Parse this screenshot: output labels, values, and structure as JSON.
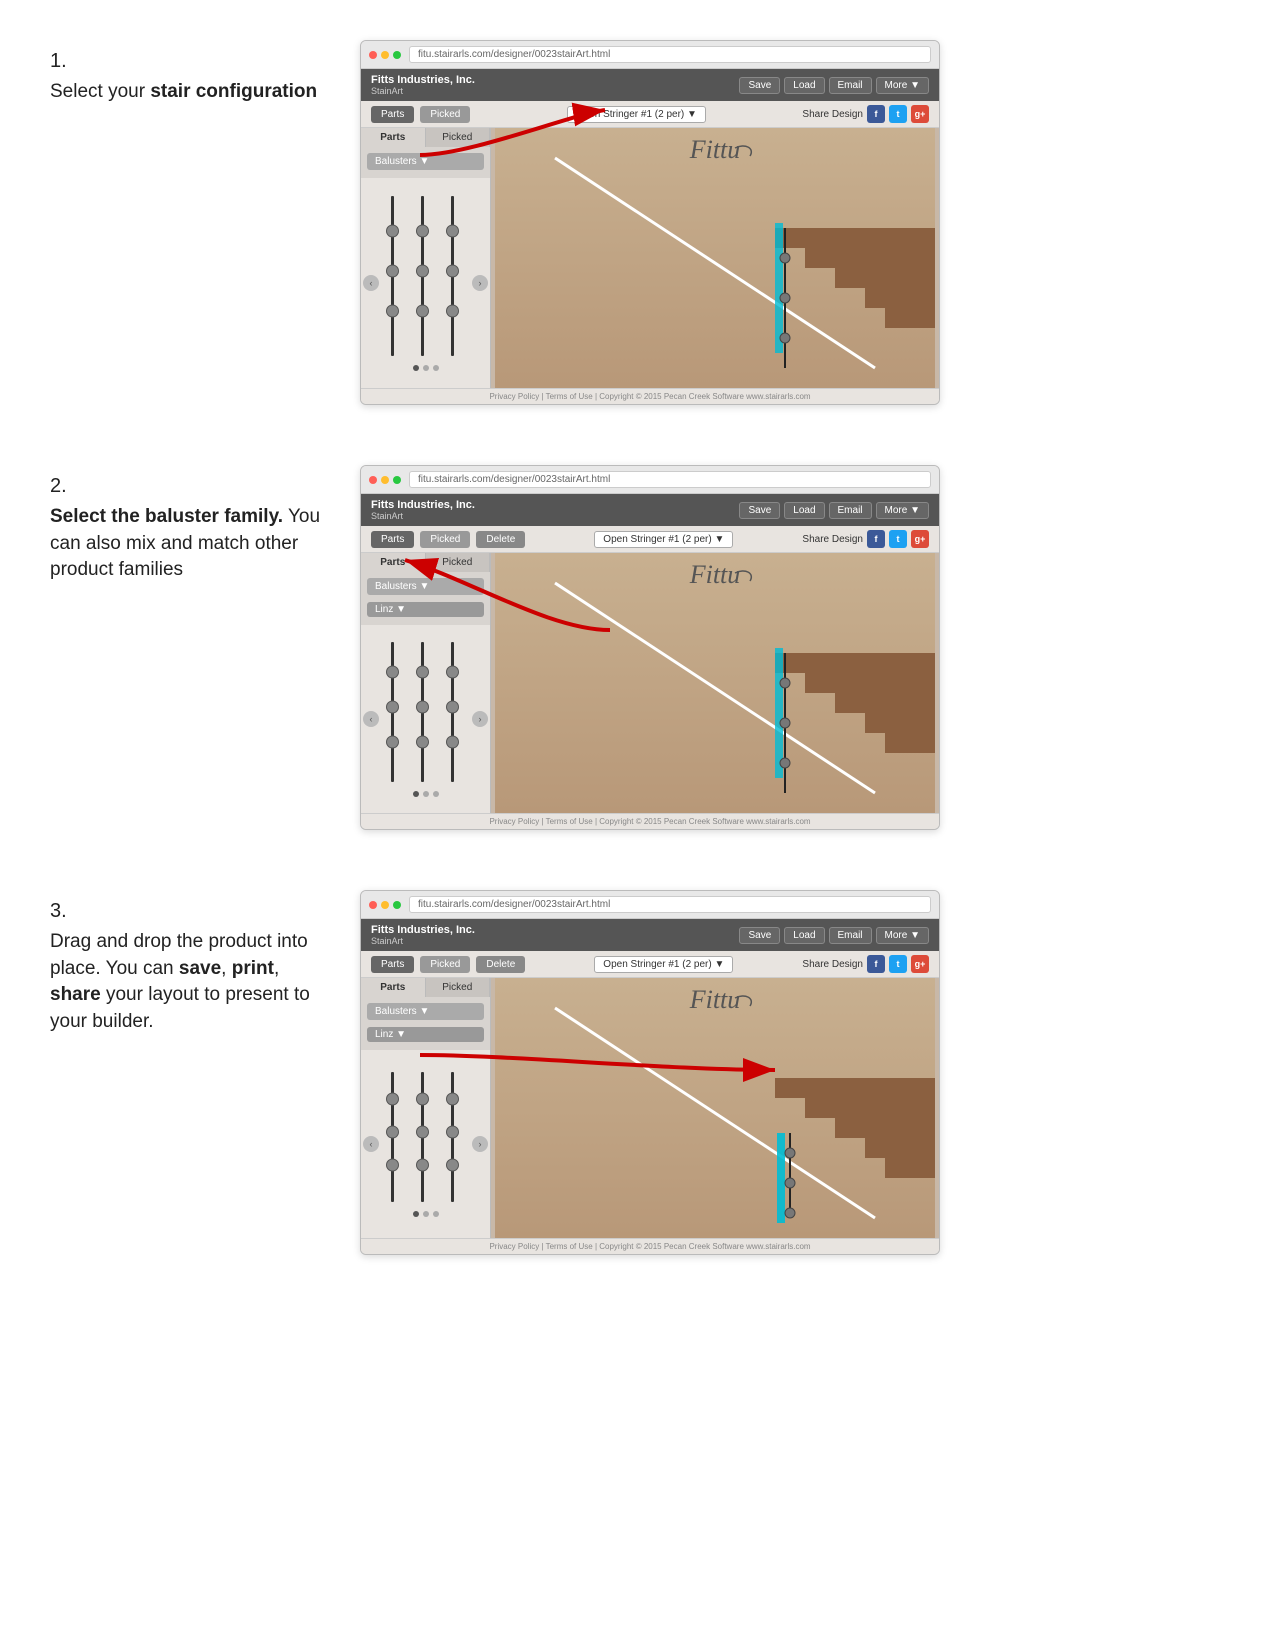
{
  "steps": [
    {
      "number": "1.",
      "title": "Select your",
      "title_bold": "stair configuration",
      "desc": ""
    },
    {
      "number": "2.",
      "title": "Select the baluster family.",
      "title_normal": " You can also mix and match other product families",
      "desc": ""
    },
    {
      "number": "3.",
      "title_normal": "Drag and drop the product into place. You can ",
      "saves": "save",
      "comma1": ", ",
      "prints": "print",
      "comma2": ", ",
      "shares": "share",
      "rest": " your layout to present to your builder.",
      "desc": ""
    }
  ],
  "app": {
    "logo": "Fitts Industries, Inc.",
    "logo_sub": "StainArt",
    "url": "fitu.stairarls.com/designer/0023stairArt.html",
    "buttons": {
      "save": "Save",
      "load": "Load",
      "email": "Email",
      "more": "More ▼"
    },
    "toolbar": {
      "parts": "Parts",
      "picked": "Picked",
      "delete": "Delete",
      "dropdown": "Open Stringer #1 (2 per) ▼",
      "share": "Share Design"
    },
    "panels": {
      "balusters": "Balusters ▼",
      "linz": "Linz ▼"
    },
    "footer": "Privacy Policy  |  Terms of Use  |  Copyright © 2015 Pecan Creek Software  www.stairarls.com"
  }
}
